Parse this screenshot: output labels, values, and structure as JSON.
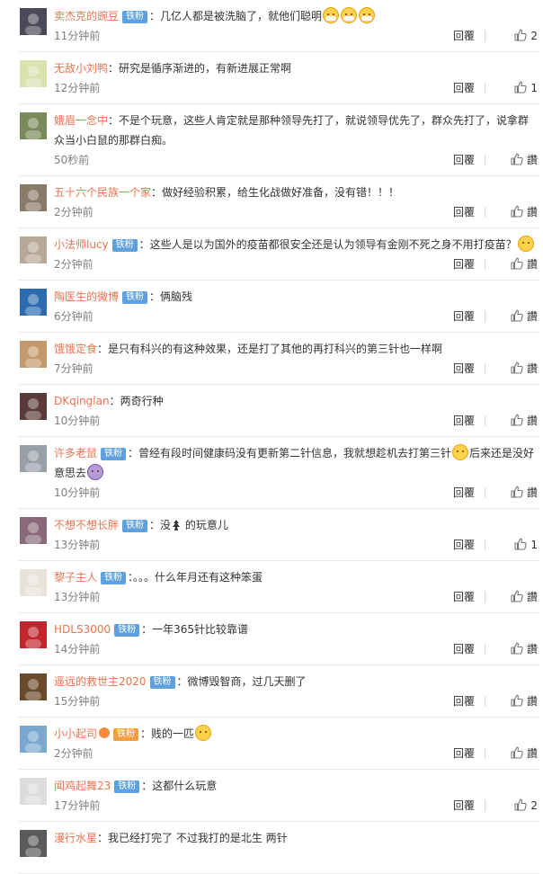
{
  "colors": {
    "username": "#eb7350",
    "badge": "#5fa1de",
    "time": "#808080"
  },
  "labels": {
    "reply": "回覆",
    "like_icon": "thumbs-up-icon"
  },
  "comments": [
    {
      "user": "卖杰克的豌豆",
      "badge": "铁粉",
      "text": "：几亿人都是被洗脑了，就他们聪明",
      "emojis": [
        "mask-face",
        "mask-face",
        "mask-face"
      ],
      "time": "11分钟前",
      "likes": "2",
      "avatar": "#4a4a5a"
    },
    {
      "user": "无敌小刘鸭",
      "badge": "",
      "text": "：研究是循序渐进的，有新进展正常啊",
      "time": "12分钟前",
      "likes": "1",
      "avatar": "#d8e3b0"
    },
    {
      "user": "娥眉一念中",
      "badge": "",
      "text": "：不是个玩意，这些人肯定就是那种领导先打了，就说领导优先了，群众先打了，说拿群众当小白鼠的那群白痴。",
      "time": "50秒前",
      "likes": "讚",
      "avatar": "#7a8a5a"
    },
    {
      "user": "五十六个民族一个家",
      "badge": "",
      "text": "：做好经验积累，给生化战做好准备，没有错！！！",
      "time": "2分钟前",
      "likes": "讚",
      "avatar": "#8a7a68"
    },
    {
      "user": "小法师lucy",
      "badge": "铁粉",
      "text": "：这些人是以为国外的疫苗都很安全还是认为领导有金刚不死之身不用打疫苗？",
      "emojis": [
        "smile"
      ],
      "time": "2分钟前",
      "likes": "讚",
      "avatar": "#b8a898"
    },
    {
      "user": "陶医生的微博",
      "badge": "铁粉",
      "text": "：俩脑残",
      "time": "6分钟前",
      "likes": "讚",
      "avatar": "#2b6cb0"
    },
    {
      "user": "饿饿定食",
      "badge": "",
      "text": "：是只有科兴的有这种效果，还是打了其他的再打科兴的第三针也一样啊",
      "time": "7分钟前",
      "likes": "讚",
      "avatar": "#c49a6c"
    },
    {
      "user": "DKqinglan",
      "badge": "",
      "text": "：两奇行种",
      "time": "10分钟前",
      "likes": "讚",
      "avatar": "#5a3a3a"
    },
    {
      "user": "许多老鼠",
      "badge": "铁粉",
      "text": "：曾经有段时间健康码没有更新第二针信息，我就想趁机去打第三针",
      "emojis": [
        "glasses-face"
      ],
      "text2": "后来还是没好意思去",
      "emojis2": [
        "dizzy-face"
      ],
      "time": "10分钟前",
      "likes": "讚",
      "avatar": "#9aa0a8"
    },
    {
      "user": "不想不想长胖",
      "badge": "铁粉",
      "text": "：没",
      "text_after_glyph": " 的玩意儿",
      "time": "13分钟前",
      "likes": "1",
      "avatar": "#8a6a7a"
    },
    {
      "user": "黎子主人",
      "badge": "铁粉",
      "text": "：。。。什么年月还有这种笨蛋",
      "time": "13分钟前",
      "likes": "讚",
      "avatar": "#e8e4dc"
    },
    {
      "user": "HDLS3000",
      "badge": "铁粉",
      "text": "：一年365针比较靠谱",
      "time": "14分钟前",
      "likes": "讚",
      "avatar": "#c0262c"
    },
    {
      "user": "遥远的救世主2020",
      "badge": "铁粉",
      "text": "：微博毁智商，过几天删了",
      "time": "15分钟前",
      "likes": "讚",
      "avatar": "#6b4a2a"
    },
    {
      "user": "小小起司",
      "badge": "铁粉",
      "badge_style": "orange",
      "vip": true,
      "text": "：贱的一匹",
      "emojis": [
        "smirk-face"
      ],
      "time": "2分钟前",
      "likes": "讚",
      "avatar": "#7aa8d0"
    },
    {
      "user": "闻鸡起舞23",
      "badge": "铁粉",
      "text": "：这都什么玩意",
      "time": "17分钟前",
      "likes": "2",
      "avatar": "#dcdcdc"
    },
    {
      "user": "漫行水星",
      "badge": "",
      "text": "：我已经打完了 不过我打的是北生 两针",
      "time": "",
      "likes": "",
      "avatar": "#5a5a5a"
    }
  ]
}
